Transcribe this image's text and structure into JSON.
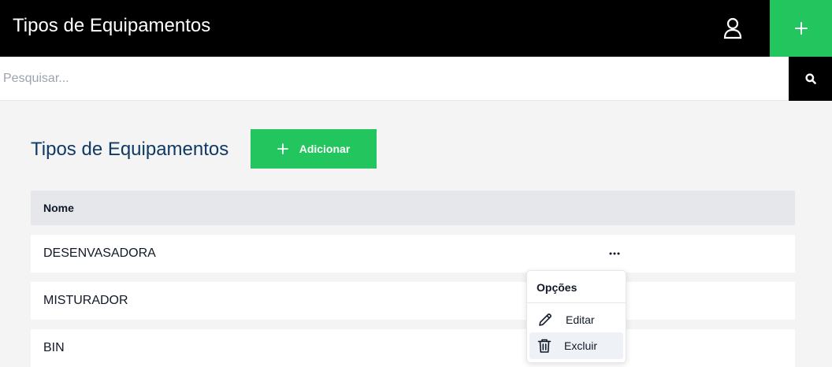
{
  "header": {
    "title": "Tipos de Equipamentos",
    "user_icon": "user-icon",
    "add_icon": "plus-icon"
  },
  "search": {
    "placeholder": "Pesquisar...",
    "value": "",
    "icon": "search-icon"
  },
  "page": {
    "title": "Tipos de Equipamentos",
    "add_button_label": "Adicionar"
  },
  "table": {
    "columns": [
      "Nome"
    ],
    "rows": [
      {
        "nome": "DESENVASADORA"
      },
      {
        "nome": "MISTURADOR"
      },
      {
        "nome": "BIN"
      }
    ]
  },
  "options_menu": {
    "title": "Opções",
    "items": [
      {
        "label": "Editar",
        "icon": "pencil-icon"
      },
      {
        "label": "Excluir",
        "icon": "trash-icon"
      }
    ]
  },
  "colors": {
    "topbar": "#000000",
    "accent_green": "#22c55e",
    "page_title": "#0f3a64",
    "background": "#f4f4f5"
  }
}
